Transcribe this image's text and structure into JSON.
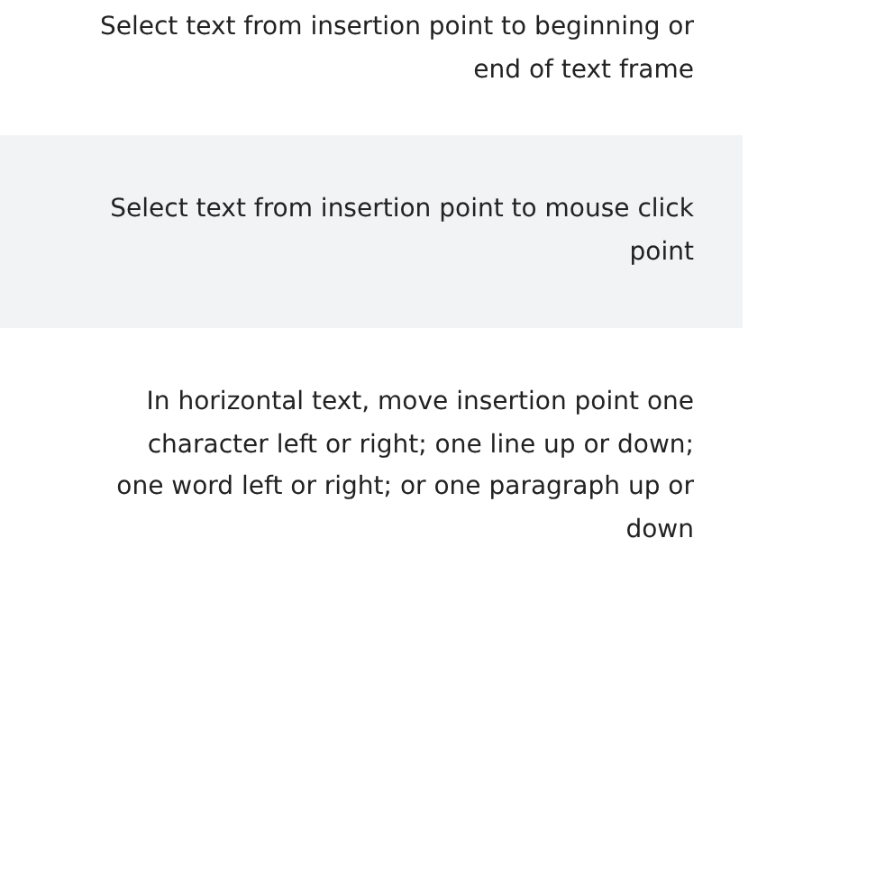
{
  "rows": [
    {
      "description": "Select text from insertion point to beginning or end of text frame",
      "shaded": false
    },
    {
      "description": "Select text from insertion point to mouse click point",
      "shaded": true
    },
    {
      "description": "In horizontal text, move insertion point one character left or right; one line up or down; one word left or right; or one paragraph up or down",
      "shaded": false
    }
  ]
}
